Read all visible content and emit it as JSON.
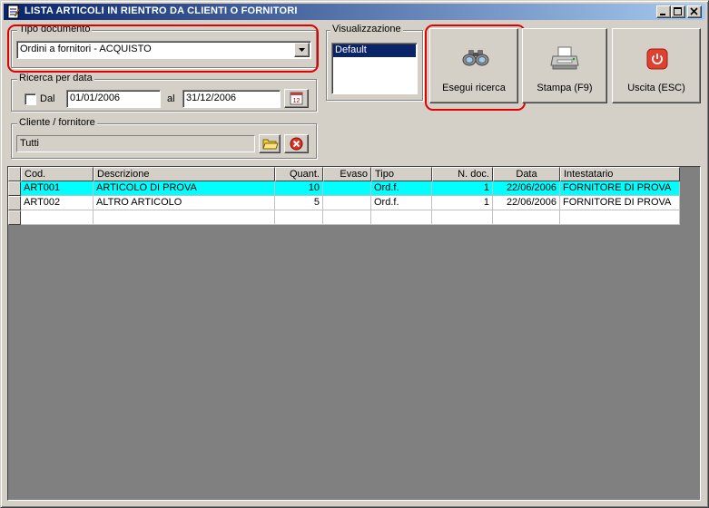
{
  "window": {
    "title": "LISTA ARTICOLI IN RIENTRO DA CLIENTI O FORNITORI",
    "minimize_glyph": "_",
    "maximize_glyph": "□",
    "close_glyph": "✕"
  },
  "tipo_documento": {
    "legend": "Tipo documento",
    "value": "Ordini a fornitori - ACQUISTO"
  },
  "ricerca_data": {
    "legend": "Ricerca per data",
    "checkbox_label": "Dal",
    "checked": false,
    "from_date": "01/01/2006",
    "to_label": "al",
    "to_date": "31/12/2006",
    "calendar_day": "12"
  },
  "cliente": {
    "legend": "Cliente / fornitore",
    "value": "Tutti"
  },
  "visualizzazione": {
    "legend": "Visualizzazione",
    "items": [
      "Default"
    ],
    "selected": 0
  },
  "buttons": {
    "esegui": "Esegui ricerca",
    "stampa": "Stampa (F9)",
    "uscita": "Uscita (ESC)"
  },
  "grid": {
    "columns": [
      "Cod.",
      "Descrizione",
      "Quant.",
      "Evaso",
      "Tipo",
      "N. doc.",
      "Data",
      "Intestatario"
    ],
    "rows": [
      [
        "ART001",
        "ARTICOLO DI PROVA",
        "10",
        "",
        "Ord.f.",
        "1",
        "22/06/2006",
        "FORNITORE DI PROVA"
      ],
      [
        "ART002",
        "ALTRO ARTICOLO",
        "5",
        "",
        "Ord.f.",
        "1",
        "22/06/2006",
        "FORNITORE DI PROVA"
      ],
      [
        "",
        "",
        "",
        "",
        "",
        "",
        "",
        ""
      ]
    ],
    "selected_row": 0
  },
  "colors": {
    "title_start": "#0a246a",
    "title_end": "#a6caf0",
    "selection": "#00ffff",
    "list_selection": "#0a246a",
    "highlight_outline": "#e00000",
    "window_bg": "#d4d0c8"
  }
}
